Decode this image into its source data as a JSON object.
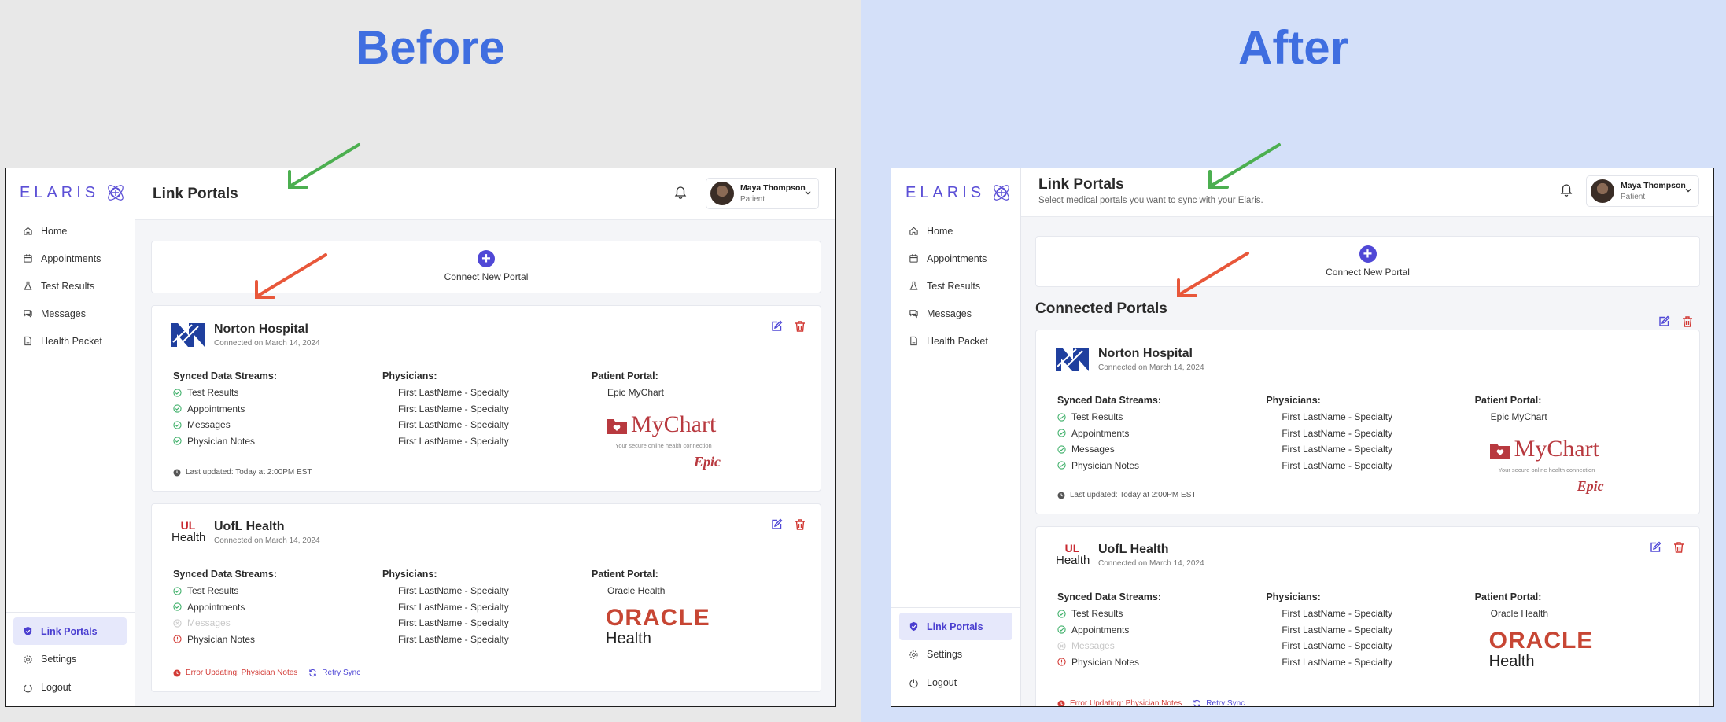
{
  "labels": {
    "before": "Before",
    "after": "After"
  },
  "app": {
    "logo": "ELARIS",
    "nav": [
      {
        "label": "Home",
        "icon": "home-icon"
      },
      {
        "label": "Appointments",
        "icon": "calendar-icon"
      },
      {
        "label": "Test Results",
        "icon": "flask-icon"
      },
      {
        "label": "Messages",
        "icon": "chat-icon"
      },
      {
        "label": "Health Packet",
        "icon": "document-icon"
      }
    ],
    "nav_bottom": [
      {
        "label": "Link Portals",
        "icon": "shield-icon",
        "active": true
      },
      {
        "label": "Settings",
        "icon": "gear-icon"
      },
      {
        "label": "Logout",
        "icon": "power-icon"
      }
    ],
    "page_title": "Link Portals",
    "subtitle": "Select medical portals you want to sync with your Elaris.",
    "user": {
      "name": "Maya Thompson",
      "role": "Patient"
    },
    "connect_label": "Connect New Portal",
    "section_title": "Connected Portals",
    "headers": {
      "streams": "Synced Data Streams:",
      "physicians": "Physicians:",
      "portal": "Patient Portal:"
    },
    "cards": [
      {
        "name": "Norton Hospital",
        "connected": "Connected on March 14, 2024",
        "streams": [
          {
            "label": "Test Results",
            "status": "ok"
          },
          {
            "label": "Appointments",
            "status": "ok"
          },
          {
            "label": "Messages",
            "status": "ok"
          },
          {
            "label": "Physician Notes",
            "status": "ok"
          }
        ],
        "physicians": [
          "First LastName - Specialty",
          "First LastName - Specialty",
          "First LastName - Specialty",
          "First LastName - Specialty"
        ],
        "portal": "Epic MyChart",
        "mychart": {
          "brand": "MyChart",
          "tagline": "Your secure online health connection",
          "vendor": "Epic"
        },
        "footer": {
          "updated": "Last updated: Today at 2:00PM EST"
        }
      },
      {
        "name": "UofL Health",
        "logo_top": "UL",
        "logo_bottom": "Health",
        "connected": "Connected on March 14, 2024",
        "streams": [
          {
            "label": "Test Results",
            "status": "ok"
          },
          {
            "label": "Appointments",
            "status": "ok"
          },
          {
            "label": "Messages",
            "status": "disabled"
          },
          {
            "label": "Physician Notes",
            "status": "error"
          }
        ],
        "physicians": [
          "First LastName - Specialty",
          "First LastName - Specialty",
          "First LastName - Specialty",
          "First LastName - Specialty"
        ],
        "portal": "Oracle Health",
        "oracle": {
          "line1": "ORACLE",
          "line2": "Health"
        },
        "footer": {
          "error": "Error Updating: Physician Notes",
          "retry": "Retry Sync"
        }
      }
    ]
  },
  "colors": {
    "accent": "#5048d6",
    "heading": "#3f6ee0",
    "ok": "#3fb06a",
    "error": "#d23a35",
    "arrow_green": "#4caf50",
    "arrow_orange": "#e8573a"
  }
}
